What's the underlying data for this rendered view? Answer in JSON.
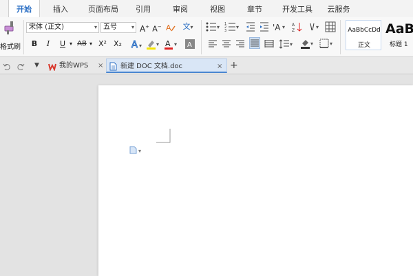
{
  "menu": {
    "tabs": [
      "开始",
      "插入",
      "页面布局",
      "引用",
      "审阅",
      "视图",
      "章节",
      "开发工具",
      "云服务"
    ],
    "active_index": 0
  },
  "ribbon": {
    "format_painter_label": "格式刷",
    "font_name": "宋体 (正文)",
    "font_size": "五号",
    "bold": "B",
    "italic": "I",
    "underline": "U",
    "strike": "AB",
    "superscript": "X²",
    "subscript": "X₂",
    "style_normal_preview": "AaBbCcDd",
    "style_normal_label": "正文",
    "style_heading_preview": "AaB",
    "style_heading_label": "标题 1"
  },
  "doc_tabs": {
    "home_tab": "我的WPS",
    "active_tab": "新建 DOC 文档.doc",
    "add": "+",
    "close": "×"
  },
  "colors": {
    "accent": "#2b6fc4",
    "wps_red": "#d9372b",
    "font_color_red": "#e02020",
    "highlight_yellow": "#f5e400"
  }
}
